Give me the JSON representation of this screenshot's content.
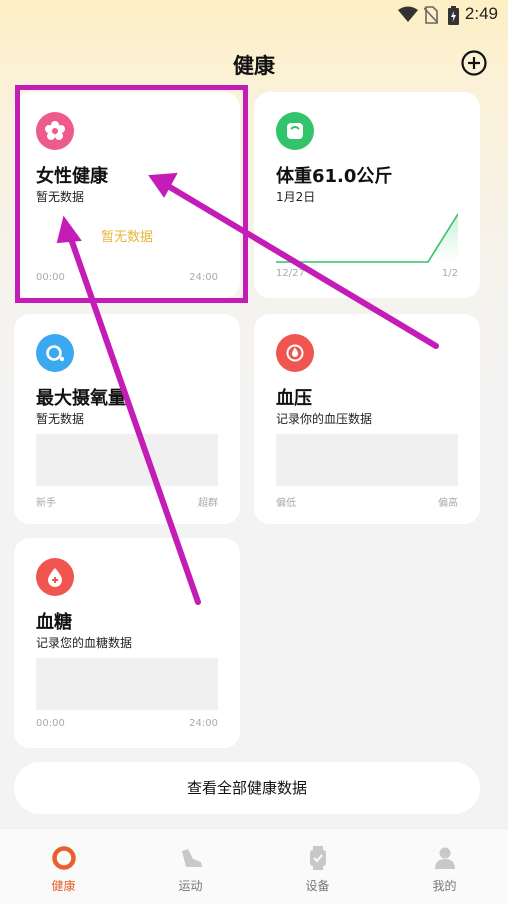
{
  "status_bar": {
    "time": "2:49",
    "icons": [
      "wifi-icon",
      "no-sim-icon",
      "battery-charging-icon"
    ]
  },
  "header": {
    "title": "健康",
    "add_icon": "plus-circle-icon"
  },
  "cards": {
    "female": {
      "title": "女性健康",
      "subtitle": "暂无数据",
      "center_text": "暂无数据",
      "axis_start": "00:00",
      "axis_end": "24:00",
      "icon": "flower-icon",
      "color": "#ee5a8a"
    },
    "weight": {
      "title": "体重61.0公斤",
      "subtitle": "1月2日",
      "axis_start": "12/27",
      "axis_end": "1/2",
      "icon": "scale-icon",
      "color": "#31c46a",
      "values": [
        0,
        0,
        0,
        0,
        0,
        0,
        61.0
      ]
    },
    "vo2": {
      "title": "最大摄氧量",
      "subtitle": "暂无数据",
      "axis_start": "新手",
      "axis_end": "超群",
      "icon": "oxygen-icon",
      "color": "#3ba8f2"
    },
    "bp": {
      "title": "血压",
      "subtitle": "记录你的血压数据",
      "axis_start": "偏低",
      "axis_end": "偏高",
      "icon": "blood-pressure-icon",
      "color": "#f0564f"
    },
    "glucose": {
      "title": "血糖",
      "subtitle": "记录您的血糖数据",
      "axis_start": "00:00",
      "axis_end": "24:00",
      "icon": "blood-drop-plus-icon",
      "color": "#f0564f"
    }
  },
  "all_data_button": "查看全部健康数据",
  "nav": [
    {
      "label": "健康",
      "icon": "health-ring-icon",
      "active": true
    },
    {
      "label": "运动",
      "icon": "shoe-icon",
      "active": false
    },
    {
      "label": "设备",
      "icon": "watch-icon",
      "active": false
    },
    {
      "label": "我的",
      "icon": "person-icon",
      "active": false
    }
  ],
  "accent_color": "#e8602c",
  "annotation_color": "#c41cb7"
}
